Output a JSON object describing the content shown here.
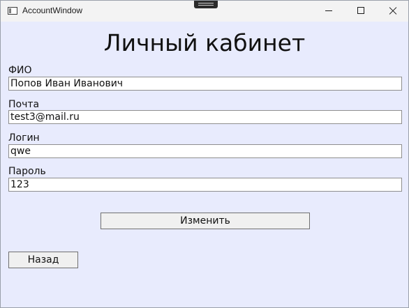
{
  "window": {
    "title": "AccountWindow"
  },
  "page": {
    "title": "Личный кабинет"
  },
  "form": {
    "fields": [
      {
        "label": "ФИО",
        "value": "Попов Иван Иванович"
      },
      {
        "label": "Почта",
        "value": "test3@mail.ru"
      },
      {
        "label": "Логин",
        "value": "qwe"
      },
      {
        "label": "Пароль",
        "value": "123"
      }
    ]
  },
  "buttons": {
    "change_label": "Изменить",
    "back_label": "Назад"
  },
  "icons": {
    "app": "window-app-icon",
    "minimize": "minimize-icon",
    "maximize": "maximize-icon",
    "close": "close-icon"
  },
  "colors": {
    "background": "#e8ebfd",
    "button": "#f0f0f0"
  }
}
